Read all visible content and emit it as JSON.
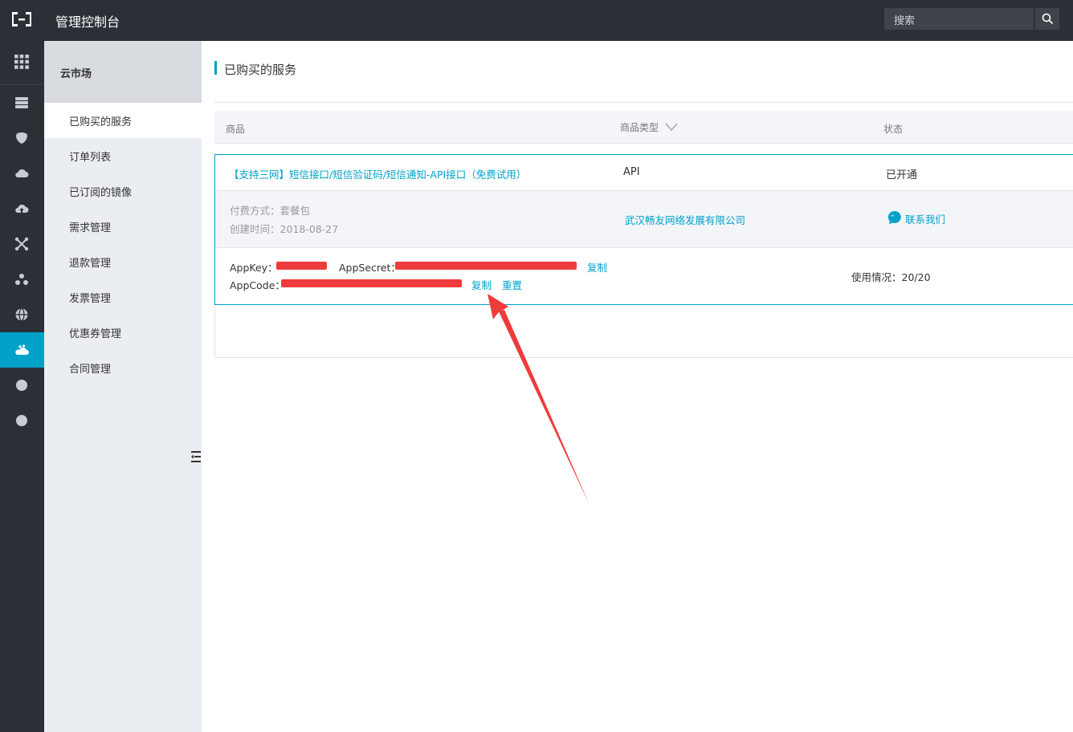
{
  "header": {
    "title": "管理控制台",
    "search_placeholder": "搜索"
  },
  "iconbar": [
    {
      "icon": "grid-icon"
    },
    {
      "icon": "server-icon"
    },
    {
      "icon": "shield-icon"
    },
    {
      "icon": "cloud-icon"
    },
    {
      "icon": "cloud-upload-icon"
    },
    {
      "icon": "network-icon"
    },
    {
      "icon": "nodes-icon"
    },
    {
      "icon": "globe-icon"
    },
    {
      "icon": "market-icon",
      "active": true
    },
    {
      "icon": "circle-icon"
    },
    {
      "icon": "circle-icon"
    }
  ],
  "sidebar": {
    "title": "云市场",
    "items": [
      {
        "label": "已购买的服务",
        "active": true
      },
      {
        "label": "订单列表"
      },
      {
        "label": "已订阅的镜像"
      },
      {
        "label": "需求管理"
      },
      {
        "label": "退款管理"
      },
      {
        "label": "发票管理"
      },
      {
        "label": "优惠券管理"
      },
      {
        "label": "合同管理"
      }
    ]
  },
  "main": {
    "title": "已购买的服务",
    "columns": {
      "product": "商品",
      "type": "商品类型",
      "status": "状态"
    },
    "order": {
      "product_name": "【支持三网】短信接口/短信验证码/短信通知-API接口（免费试用）",
      "type": "API",
      "status": "已开通",
      "payment": "付费方式：套餐包",
      "created": "创建时间：2018-08-27",
      "vendor": "武汉畅友网络发展有限公司",
      "contact": "联系我们",
      "appkey_label": "AppKey：",
      "appsecret_label": "AppSecret：",
      "appcode_label": "AppCode：",
      "copy1": "复制",
      "copy2": "复制",
      "reset": "重置",
      "usage": "使用情况：20/20"
    }
  },
  "colors": {
    "accent": "#00a2ca",
    "topbar": "#2b3036",
    "redaction": "#ee3b3b"
  }
}
